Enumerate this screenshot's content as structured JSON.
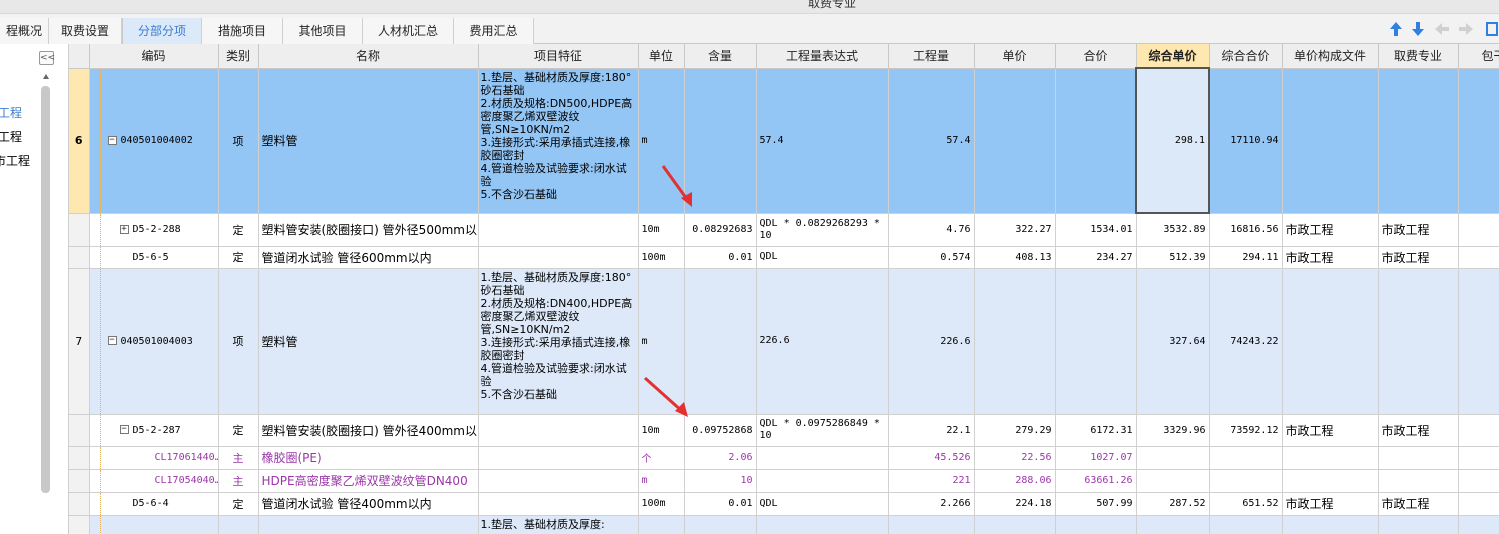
{
  "ribbon": {
    "cut_label": "取费专业"
  },
  "tabs": [
    {
      "label": "程概况",
      "active": false
    },
    {
      "label": "取费设置",
      "active": false
    },
    {
      "label": "分部分项",
      "active": true
    },
    {
      "label": "措施项目",
      "active": false
    },
    {
      "label": "其他项目",
      "active": false
    },
    {
      "label": "人材机汇总",
      "active": false
    },
    {
      "label": "费用汇总",
      "active": false
    }
  ],
  "toolbar_icons": [
    "move-up-icon",
    "move-down-icon",
    "back-icon",
    "forward-icon",
    "panel-icon"
  ],
  "left_panel": {
    "collapse_label": "<<",
    "items": [
      {
        "label": "工程",
        "active": true
      },
      {
        "label": "工程",
        "active": false
      },
      {
        "label": "市工程",
        "active": false
      }
    ]
  },
  "columns": [
    "",
    "编码",
    "类别",
    "名称",
    "项目特征",
    "单位",
    "含量",
    "工程量表达式",
    "工程量",
    "单价",
    "合价",
    "综合单价",
    "综合合价",
    "单价构成文件",
    "取费专业",
    "包干"
  ],
  "rows": [
    {
      "style": "sel",
      "rownum": "6",
      "indent": 0,
      "toggle": "−",
      "code": "040501004002",
      "type": "项",
      "name": "塑料管",
      "features": "1.垫层、基础材质及厚度:180° 砂石基础\n2.材质及规格:DN500,HDPE高密度聚乙烯双壁波纹管,SN≥10KN/m2\n3.连接形式:采用承插式连接,橡胶圈密封\n4.管道检验及试验要求:闭水试验\n5.不含沙石基础",
      "unit": "m",
      "content": "",
      "expr": "57.4",
      "qty": "57.4",
      "price": "",
      "total": "",
      "unit_comp": "298.1",
      "comp_total": "17110.94",
      "file": "",
      "spec": "",
      "baogan": ""
    },
    {
      "style": "white",
      "rownum": "",
      "indent": 1,
      "toggle": "+",
      "code": "D5-2-288",
      "type": "定",
      "name": "塑料管安装(胶圈接口) 管外径500mm以内",
      "features": "",
      "unit": "10m",
      "content": "0.08292683",
      "expr": "QDL * 0.0829268293 * 10",
      "qty": "4.76",
      "price": "322.27",
      "total": "1534.01",
      "unit_comp": "3532.89",
      "comp_total": "16816.56",
      "file": "市政工程",
      "spec": "市政工程",
      "baogan": ""
    },
    {
      "style": "white",
      "rownum": "",
      "indent": 1,
      "toggle": "",
      "code": "D5-6-5",
      "type": "定",
      "name": "管道闭水试验 管径600mm以内",
      "features": "",
      "unit": "100m",
      "content": "0.01",
      "expr": "QDL",
      "qty": "0.574",
      "price": "408.13",
      "total": "234.27",
      "unit_comp": "512.39",
      "comp_total": "294.11",
      "file": "市政工程",
      "spec": "市政工程",
      "baogan": ""
    },
    {
      "style": "blue",
      "rownum": "7",
      "indent": 0,
      "toggle": "−",
      "code": "040501004003",
      "type": "项",
      "name": "塑料管",
      "features": "1.垫层、基础材质及厚度:180° 砂石基础\n2.材质及规格:DN400,HDPE高密度聚乙烯双壁波纹管,SN≥10KN/m2\n3.连接形式:采用承插式连接,橡胶圈密封\n4.管道检验及试验要求:闭水试验\n5.不含沙石基础",
      "unit": "m",
      "content": "",
      "expr": "226.6",
      "qty": "226.6",
      "price": "",
      "total": "",
      "unit_comp": "327.64",
      "comp_total": "74243.22",
      "file": "",
      "spec": "",
      "baogan": ""
    },
    {
      "style": "white",
      "rownum": "",
      "indent": 1,
      "toggle": "−",
      "code": "D5-2-287",
      "type": "定",
      "name": "塑料管安装(胶圈接口) 管外径400mm以内",
      "features": "",
      "unit": "10m",
      "content": "0.09752868",
      "expr": "QDL * 0.0975286849 * 10",
      "qty": "22.1",
      "price": "279.29",
      "total": "6172.31",
      "unit_comp": "3329.96",
      "comp_total": "73592.12",
      "file": "市政工程",
      "spec": "市政工程",
      "baogan": ""
    },
    {
      "style": "white purple",
      "rownum": "",
      "indent": 2,
      "toggle": "",
      "code": "CL17061440…",
      "type": "主",
      "name": "橡胶圈(PE)",
      "features": "",
      "unit": "个",
      "content": "2.06",
      "expr": "",
      "qty": "45.526",
      "price": "22.56",
      "total": "1027.07",
      "unit_comp": "",
      "comp_total": "",
      "file": "",
      "spec": "",
      "baogan": ""
    },
    {
      "style": "white purple",
      "rownum": "",
      "indent": 2,
      "toggle": "",
      "code": "CL17054040…",
      "type": "主",
      "name": "HDPE高密度聚乙烯双壁波纹管DN400",
      "features": "",
      "unit": "m",
      "content": "10",
      "expr": "",
      "qty": "221",
      "price": "288.06",
      "total": "63661.26",
      "unit_comp": "",
      "comp_total": "",
      "file": "",
      "spec": "",
      "baogan": ""
    },
    {
      "style": "white",
      "rownum": "",
      "indent": 1,
      "toggle": "",
      "code": "D5-6-4",
      "type": "定",
      "name": "管道闭水试验 管径400mm以内",
      "features": "",
      "unit": "100m",
      "content": "0.01",
      "expr": "QDL",
      "qty": "2.266",
      "price": "224.18",
      "total": "507.99",
      "unit_comp": "287.52",
      "comp_total": "651.52",
      "file": "市政工程",
      "spec": "市政工程",
      "baogan": ""
    },
    {
      "style": "blue",
      "rownum": "",
      "indent": 0,
      "toggle": "",
      "code": "",
      "type": "",
      "name": "",
      "features": "1.垫层、基础材质及厚度:",
      "unit": "",
      "content": "",
      "expr": "",
      "qty": "",
      "price": "",
      "total": "",
      "unit_comp": "",
      "comp_total": "",
      "file": "",
      "spec": "",
      "baogan": ""
    }
  ],
  "annotations": [
    "red-arrow",
    "red-arrow"
  ]
}
